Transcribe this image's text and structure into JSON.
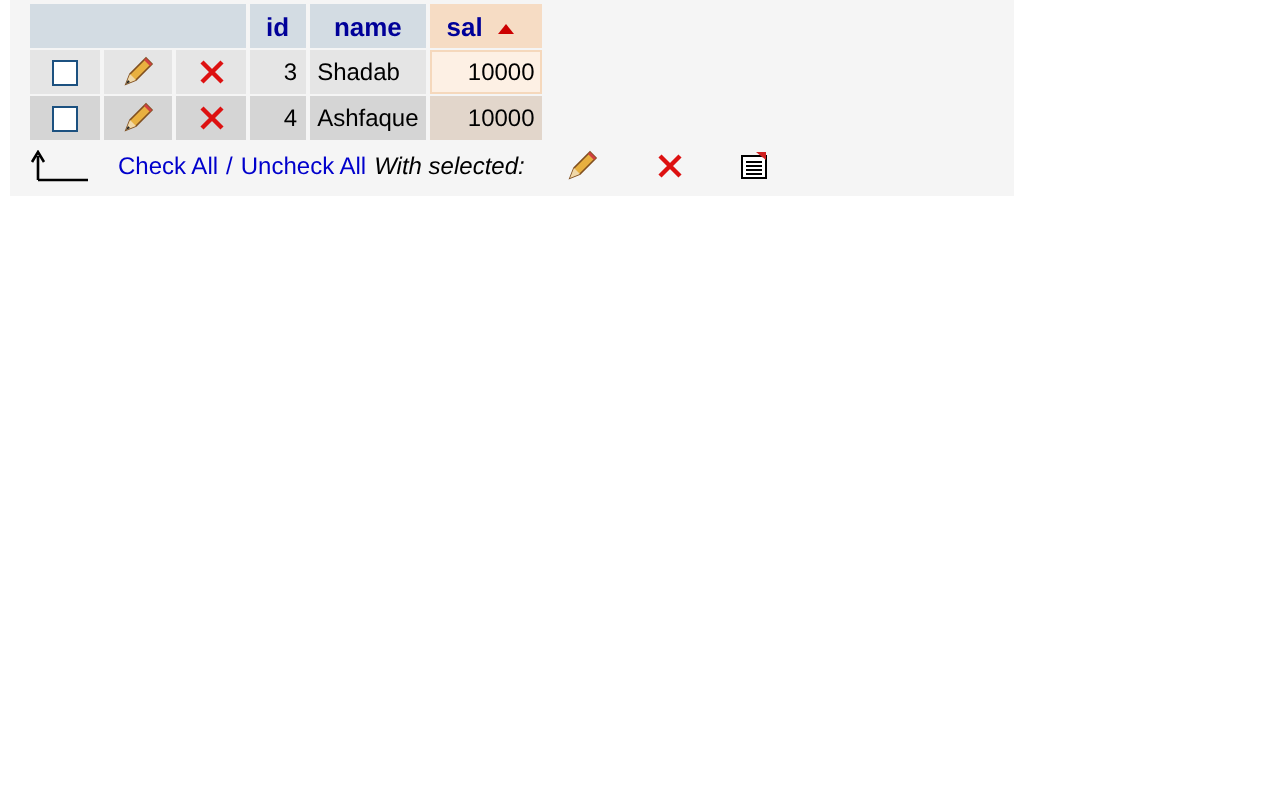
{
  "table": {
    "columns": [
      {
        "label": "id",
        "sorted": false
      },
      {
        "label": "name",
        "sorted": false
      },
      {
        "label": "sal",
        "sorted": true
      }
    ],
    "rows": [
      {
        "checked": false,
        "id": "3",
        "name": "Shadab",
        "sal": "10000"
      },
      {
        "checked": false,
        "id": "4",
        "name": "Ashfaque",
        "sal": "10000"
      }
    ]
  },
  "footer": {
    "check_all": "Check All",
    "separator": "/",
    "uncheck_all": "Uncheck All",
    "with_selected": "With selected:"
  }
}
